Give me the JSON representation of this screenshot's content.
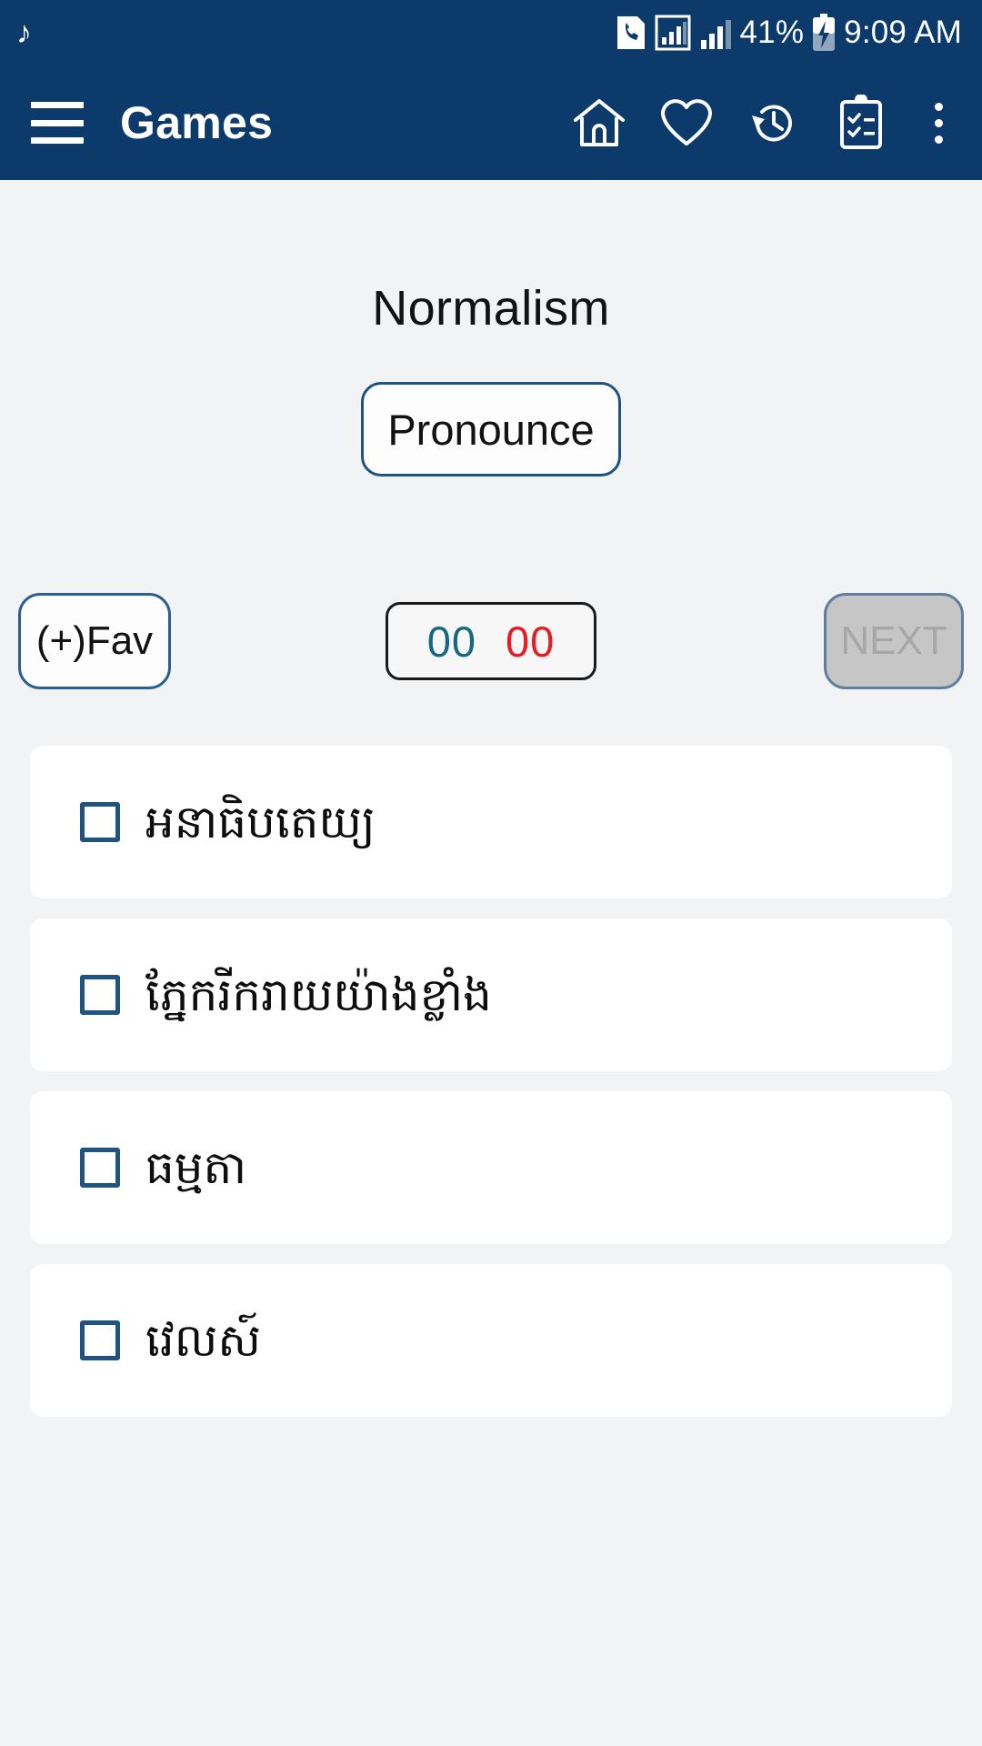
{
  "status_bar": {
    "music_icon": "music-note-icon",
    "call_icon": "call-sim-icon",
    "signal_icon_1": "signal-bars-boxed-icon",
    "signal_icon_2": "signal-bars-icon",
    "battery_percent": "41%",
    "battery_icon": "battery-charging-icon",
    "time": "9:09 AM"
  },
  "app_bar": {
    "menu_icon": "hamburger-menu-icon",
    "title": "Games",
    "actions": [
      {
        "name": "home-icon",
        "label": "Home"
      },
      {
        "name": "heart-icon",
        "label": "Favorites"
      },
      {
        "name": "history-icon",
        "label": "History"
      },
      {
        "name": "clipboard-checklist-icon",
        "label": "Tests"
      }
    ],
    "overflow_icon": "overflow-menu-icon"
  },
  "main": {
    "word": "Normalism",
    "pronounce_label": "Pronounce",
    "fav_label": "(+)Fav",
    "score": {
      "correct": "00",
      "wrong": "00",
      "correct_color": "#13697f",
      "wrong_color": "#e61c22"
    },
    "next_label": "NEXT",
    "answers": [
      {
        "text": "អនាធិបតេយ្យ",
        "checked": false
      },
      {
        "text": "ភ្នែករីករាយយ៉ាងខ្លាំង",
        "checked": false
      },
      {
        "text": "ធម្មតា",
        "checked": false
      },
      {
        "text": "វេលស៍",
        "checked": false
      }
    ]
  },
  "colors": {
    "app_bar": "#0c3a6b",
    "page_background": "#f2f3f4",
    "accent_border": "#1f5382",
    "card": "#ffffff"
  }
}
